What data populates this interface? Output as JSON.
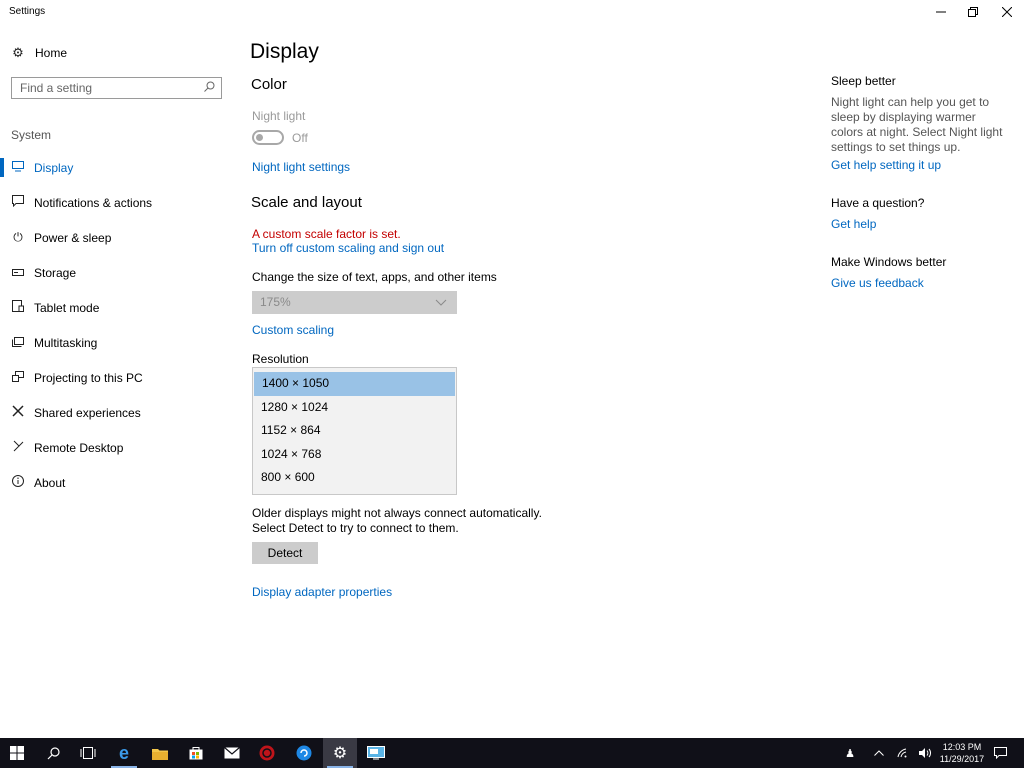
{
  "window": {
    "title": "Settings"
  },
  "sidebar": {
    "home_label": "Home",
    "search_placeholder": "Find a setting",
    "section_label": "System",
    "items": [
      {
        "label": "Display",
        "icon": "monitor-icon",
        "active": true
      },
      {
        "label": "Notifications & actions",
        "icon": "notification-icon"
      },
      {
        "label": "Power & sleep",
        "icon": "power-icon"
      },
      {
        "label": "Storage",
        "icon": "storage-icon"
      },
      {
        "label": "Tablet mode",
        "icon": "tablet-icon"
      },
      {
        "label": "Multitasking",
        "icon": "multitasking-icon"
      },
      {
        "label": "Projecting to this PC",
        "icon": "projecting-icon"
      },
      {
        "label": "Shared experiences",
        "icon": "shared-icon"
      },
      {
        "label": "Remote Desktop",
        "icon": "remote-desktop-icon"
      },
      {
        "label": "About",
        "icon": "info-icon"
      }
    ]
  },
  "main": {
    "title": "Display",
    "color_heading": "Color",
    "night_light_label": "Night light",
    "night_light_state": "Off",
    "night_light_settings_link": "Night light settings",
    "scale_heading": "Scale and layout",
    "custom_scale_warning": "A custom scale factor is set.",
    "turn_off_link": "Turn off custom scaling and sign out",
    "size_label": "Change the size of text, apps, and other items",
    "scale_value": "175%",
    "custom_scaling_link": "Custom scaling",
    "resolution_label": "Resolution",
    "resolutions": [
      "1400 × 1050",
      "1280 × 1024",
      "1152 × 864",
      "1024 × 768",
      "800 × 600"
    ],
    "selected_resolution": "1400 × 1050",
    "older_displays_text": "Older displays might not always connect automatically. Select Detect to try to connect to them.",
    "detect_button": "Detect",
    "adapter_link": "Display adapter properties"
  },
  "right": {
    "sleep_heading": "Sleep better",
    "sleep_text": "Night light can help you get to sleep by displaying warmer colors at night. Select Night light settings to set things up.",
    "sleep_link": "Get help setting it up",
    "question_heading": "Have a question?",
    "question_link": "Get help",
    "feedback_heading": "Make Windows better",
    "feedback_link": "Give us feedback"
  },
  "taskbar": {
    "time": "12:03 PM",
    "date": "11/29/2017"
  },
  "colors": {
    "accent": "#0067c0",
    "warning": "#c30000",
    "taskbar": "#101018",
    "selected_item": "#99c2e6"
  }
}
